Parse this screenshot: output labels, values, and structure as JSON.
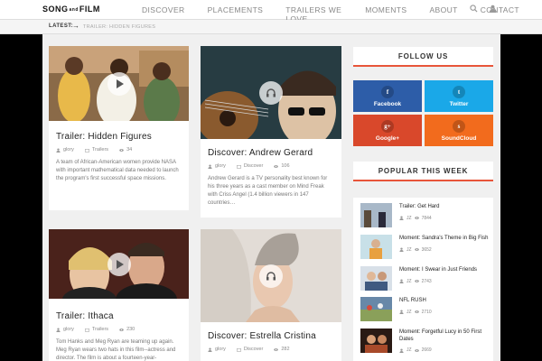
{
  "brand": {
    "logo_left": "SONG",
    "logo_mid": "and",
    "logo_right": "FILM"
  },
  "nav": [
    "DISCOVER",
    "PLACEMENTS",
    "TRAILERS WE LOVE",
    "MOMENTS",
    "ABOUT",
    "CONTACT"
  ],
  "icons": [
    "search-icon",
    "user-icon"
  ],
  "ticker": {
    "label": "LATEST:",
    "arrow": "→",
    "text": "TRAILER: HIDDEN FIGURES"
  },
  "cards": [
    {
      "title": "Trailer: Hidden Figures",
      "author": "glory",
      "category": "Trailers",
      "views": "34",
      "excerpt": "A team of African-American women provide NASA with important mathematical data needed to launch the program's first successful space missions.",
      "media": "play"
    },
    {
      "title": "Discover: Andrew Gerard",
      "author": "glory",
      "category": "Discover",
      "views": "106",
      "excerpt": "Andrew Gerard is a TV personality best known for his three years as a cast member on Mind Freak with Criss Angel (1.4 billion viewers in 147 countries…",
      "media": "audio"
    },
    {
      "title": "Trailer: Ithaca",
      "author": "glory",
      "category": "Trailers",
      "views": "230",
      "excerpt": "Tom Hanks and Meg Ryan are teaming up again. Meg Ryan wears two hats in this film--actress and director.  The film is about a fourteen-year-",
      "media": "play"
    },
    {
      "title": "Discover: Estrella Cristina",
      "author": "glory",
      "category": "Discover",
      "views": "282",
      "excerpt": "",
      "media": "audio"
    }
  ],
  "sidebar": {
    "follow_title": "FOLLOW US",
    "social": [
      {
        "label": "Facebook",
        "glyph": "f",
        "color": "#2d5da8"
      },
      {
        "label": "Twitter",
        "glyph": "t",
        "color": "#1aa8e8"
      },
      {
        "label": "Google+",
        "glyph": "g+",
        "color": "#d9482b"
      },
      {
        "label": "SoundCloud",
        "glyph": "s",
        "color": "#f26b1d"
      }
    ],
    "popular_title": "POPULAR THIS WEEK",
    "popular": [
      {
        "title": "Trailer: Get Hard",
        "author": "JZ",
        "views": "7844"
      },
      {
        "title": "Moment: Sandra's Theme in Big Fish",
        "author": "JZ",
        "views": "3652"
      },
      {
        "title": "Moment: I Swear in Just Friends",
        "author": "JZ",
        "views": "2743"
      },
      {
        "title": "NFL RUSH",
        "author": "JZ",
        "views": "2710"
      },
      {
        "title": "Moment: Forgetful Lucy in 50 First Dates",
        "author": "JZ",
        "views": "2669"
      }
    ]
  },
  "colors": {
    "accent": "#e8553a",
    "facebook": "#2d5da8",
    "twitter": "#1aa8e8",
    "google": "#d9482b",
    "soundcloud": "#f26b1d"
  }
}
